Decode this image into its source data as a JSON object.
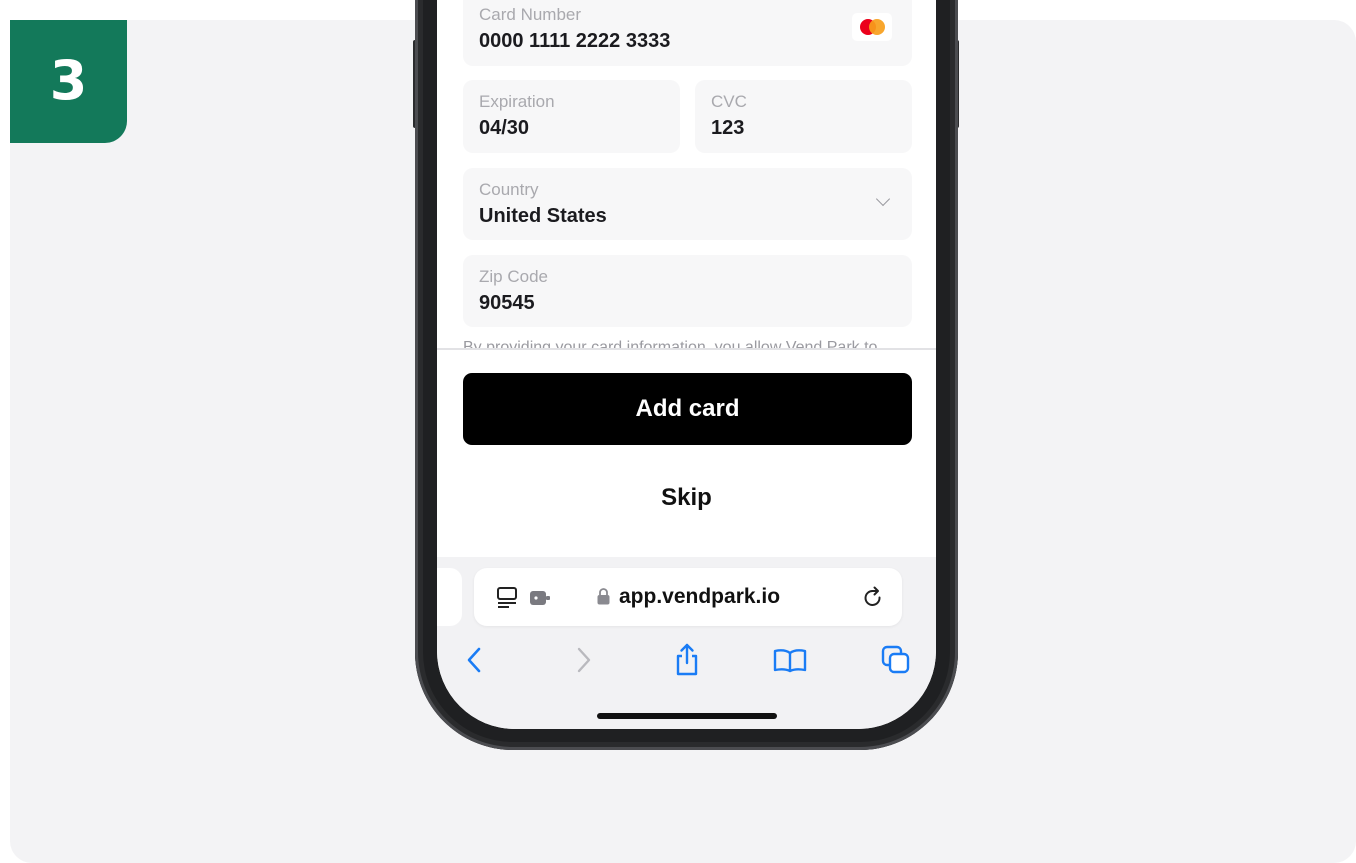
{
  "step": {
    "number": "3",
    "color": "#13795a"
  },
  "form": {
    "card_number": {
      "label": "Card Number",
      "value": "0000 1111 2222 3333",
      "brand_icon": "mastercard-icon"
    },
    "expiration": {
      "label": "Expiration",
      "value": "04/30"
    },
    "cvc": {
      "label": "CVC",
      "value": "123"
    },
    "country": {
      "label": "Country",
      "value": "United States"
    },
    "zip": {
      "label": "Zip Code",
      "value": "90545"
    },
    "disclaimer": "By providing your card information, you allow Vend Park to"
  },
  "actions": {
    "add_card_label": "Add card",
    "skip_label": "Skip"
  },
  "browser": {
    "url": "app.vendpark.io",
    "icons": [
      "reader-icon",
      "extension-icon",
      "lock-icon",
      "reload-icon"
    ],
    "nav_icons": [
      "back-icon",
      "forward-icon",
      "share-icon",
      "bookmarks-icon",
      "tabs-icon"
    ],
    "accent": "#1a7cf5"
  }
}
